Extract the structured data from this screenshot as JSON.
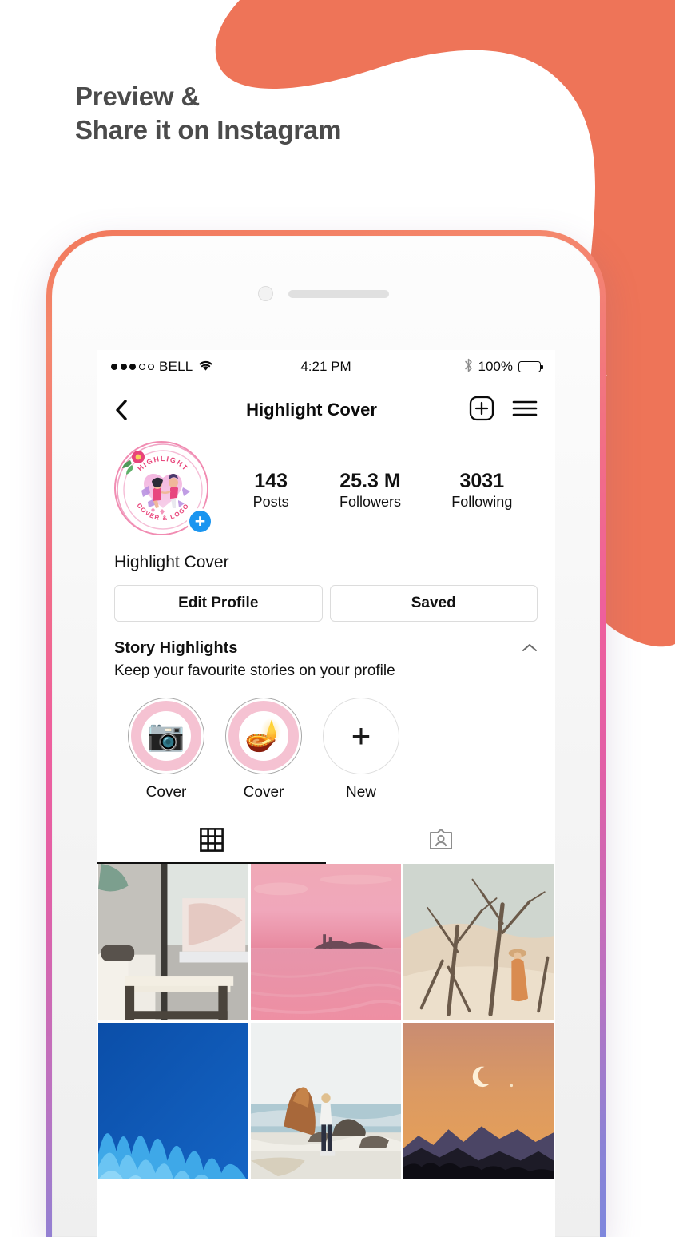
{
  "page": {
    "headline_line1": "Preview &",
    "headline_line2": "Share it on Instagram",
    "headline_color": "#4b4b4b",
    "accent_coral": "#ee7458",
    "frame_gradient_start": "#f2795c",
    "frame_gradient_end": "#7e87dd"
  },
  "status_bar": {
    "signal_dots_filled": 3,
    "signal_dots_empty": 2,
    "carrier": "BELL",
    "wifi_icon": "wifi-icon",
    "time": "4:21 PM",
    "bluetooth_icon": "bluetooth-icon",
    "battery_percent": "100%",
    "battery_icon": "battery-icon"
  },
  "nav_bar": {
    "back_icon": "back-chevron-icon",
    "title": "Highlight Cover",
    "add_icon": "plus-square-icon",
    "menu_icon": "hamburger-menu-icon"
  },
  "profile": {
    "avatar_name": "avatar",
    "avatar_logo_top_text": "HIGHLIGHT",
    "avatar_logo_bottom_text": "COVER & LOGO",
    "add_story_badge": "+",
    "bio_name": "Highlight Cover",
    "stats": [
      {
        "number": "143",
        "label": "Posts"
      },
      {
        "number": "25.3 M",
        "label": "Followers"
      },
      {
        "number": "3031",
        "label": "Following"
      }
    ],
    "buttons": [
      {
        "label": "Edit Profile",
        "name": "edit-profile-button"
      },
      {
        "label": "Saved",
        "name": "saved-button"
      }
    ]
  },
  "story_highlights": {
    "title": "Story Highlights",
    "subtitle": "Keep your favourite stories on your profile",
    "collapse_icon": "chevron-up-icon",
    "items": [
      {
        "label": "Cover",
        "icon": "camera-emoji",
        "ring": true
      },
      {
        "label": "Cover",
        "icon": "diya-candles-emoji",
        "ring": true
      },
      {
        "label": "New",
        "icon": "plus-icon",
        "ring": false
      }
    ]
  },
  "tabs": [
    {
      "name": "tab-grid",
      "icon": "grid-icon",
      "active": true
    },
    {
      "name": "tab-tagged",
      "icon": "tagged-person-icon",
      "active": false
    }
  ],
  "photo_grid": {
    "cells": [
      {
        "name": "grid-photo-interior-laptop",
        "alt": "Gray interior with bench and laptop"
      },
      {
        "name": "grid-photo-pink-sunset-water",
        "alt": "Pink sunset over water with island"
      },
      {
        "name": "grid-photo-desert-trees-woman",
        "alt": "Desert dunes with bare trees and woman"
      },
      {
        "name": "grid-photo-blue-abstract-waves",
        "alt": "Blue abstract wave shapes"
      },
      {
        "name": "grid-photo-beach-rock-person",
        "alt": "Beach with rock and person walking"
      },
      {
        "name": "grid-photo-orange-moon-mountains",
        "alt": "Orange sky crescent moon over mountains"
      }
    ]
  }
}
